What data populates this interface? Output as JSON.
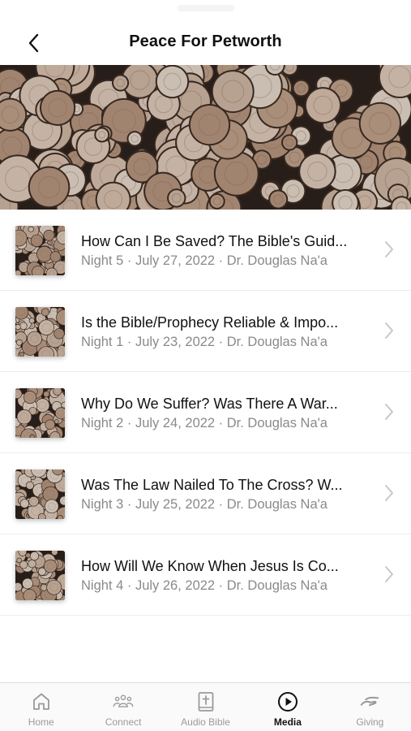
{
  "header": {
    "title": "Peace For Petworth"
  },
  "icons": {
    "back": "chevron-left-icon",
    "row_arrow": "chevron-right-icon"
  },
  "colors": {
    "text": "#111111",
    "meta": "#8a8a8a",
    "tab_inactive": "#9a9a9a",
    "tab_active": "#111111"
  },
  "items": [
    {
      "title": "How Can I Be Saved? The Bible's Guid...",
      "meta": "Night 5 · July 27, 2022 · Dr. Douglas Na'a"
    },
    {
      "title": "Is the Bible/Prophecy Reliable & Impo...",
      "meta": "Night 1 · July 23, 2022 · Dr. Douglas Na'a"
    },
    {
      "title": "Why Do We Suffer? Was There A War...",
      "meta": "Night 2 · July 24, 2022 · Dr. Douglas Na'a"
    },
    {
      "title": "Was The Law Nailed To The Cross? W...",
      "meta": "Night 3 · July 25, 2022 · Dr. Douglas Na'a"
    },
    {
      "title": "How Will We Know When Jesus Is Co...",
      "meta": "Night 4 · July 26, 2022 · Dr. Douglas Na'a"
    }
  ],
  "tabs": [
    {
      "label": "Home",
      "icon": "home-icon"
    },
    {
      "label": "Connect",
      "icon": "people-icon"
    },
    {
      "label": "Audio Bible",
      "icon": "bible-icon"
    },
    {
      "label": "Media",
      "icon": "play-circle-icon",
      "active": true
    },
    {
      "label": "Giving",
      "icon": "giving-hand-icon"
    }
  ]
}
